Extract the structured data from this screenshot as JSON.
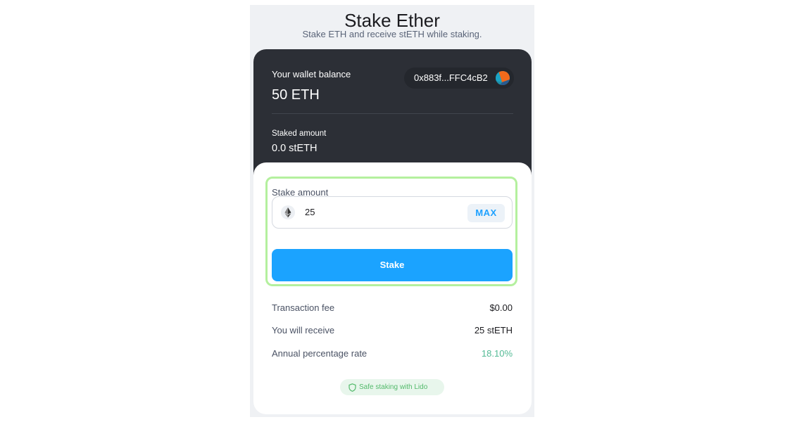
{
  "header": {
    "title": "Stake Ether",
    "subtitle": "Stake ETH and receive stETH while staking."
  },
  "wallet": {
    "balance_label": "Your wallet balance",
    "balance_value": "50 ETH",
    "address": "0x883f...FFC4cB2",
    "staked_label": "Staked amount",
    "staked_value": "0.0 stETH"
  },
  "stake_form": {
    "amount_label": "Stake amount",
    "amount_value": "25",
    "max_label": "MAX",
    "submit_label": "Stake"
  },
  "info": {
    "rows": [
      {
        "label": "Transaction fee",
        "value": "$0.00"
      },
      {
        "label": "You will receive",
        "value": "25 stETH"
      },
      {
        "label": "Annual percentage rate",
        "value": "18.10%"
      }
    ]
  },
  "footer": {
    "badge_text": "Safe staking with Lido"
  },
  "colors": {
    "accent": "#1ba3ff",
    "dark_card": "#2c2f36",
    "highlight": "#b4f09e",
    "apr_green": "#53ba95"
  },
  "icons": {
    "eth": "ethereum-icon",
    "avatar": "wallet-avatar-icon",
    "shield": "shield-icon"
  }
}
